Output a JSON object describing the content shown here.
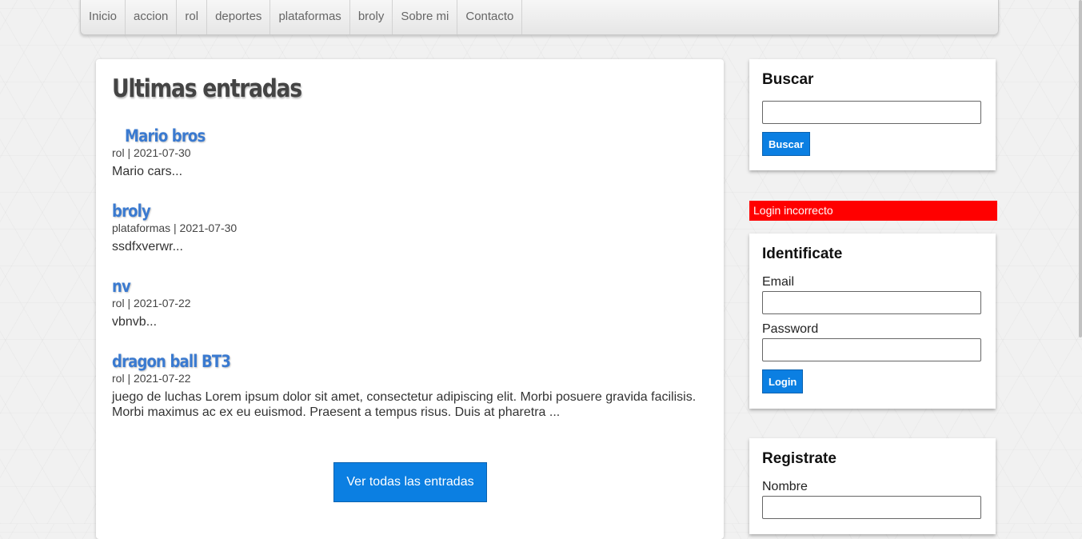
{
  "nav": {
    "items": [
      "Inicio",
      "accion",
      "rol",
      "deportes",
      "plataformas",
      "broly",
      "Sobre mi",
      "Contacto"
    ]
  },
  "main": {
    "title": "Ultimas entradas",
    "entries": [
      {
        "title": "Mario bros",
        "meta": "rol | 2021-07-30",
        "text": "Mario cars..."
      },
      {
        "title": "broly",
        "meta": "plataformas | 2021-07-30",
        "text": "ssdfxverwr..."
      },
      {
        "title": "nv",
        "meta": "rol | 2021-07-22",
        "text": "vbnvb..."
      },
      {
        "title": "dragon ball BT3",
        "meta": "rol | 2021-07-22",
        "text": "juego de luchas Lorem ipsum dolor sit amet, consectetur adipiscing elit. Morbi posuere gravida facilisis. Morbi maximus ac ex eu euismod. Praesent a tempus risus. Duis at pharetra ..."
      }
    ],
    "all_button": "Ver todas las entradas"
  },
  "search": {
    "title": "Buscar",
    "button": "Buscar",
    "value": ""
  },
  "alert": {
    "text": "Login incorrecto",
    "color": "#ff0000"
  },
  "login": {
    "title": "Identificate",
    "email_label": "Email",
    "password_label": "Password",
    "button": "Login"
  },
  "register": {
    "title": "Registrate",
    "name_label": "Nombre"
  },
  "colors": {
    "accent": "#0b7fe2",
    "link": "#3a7ad0"
  }
}
